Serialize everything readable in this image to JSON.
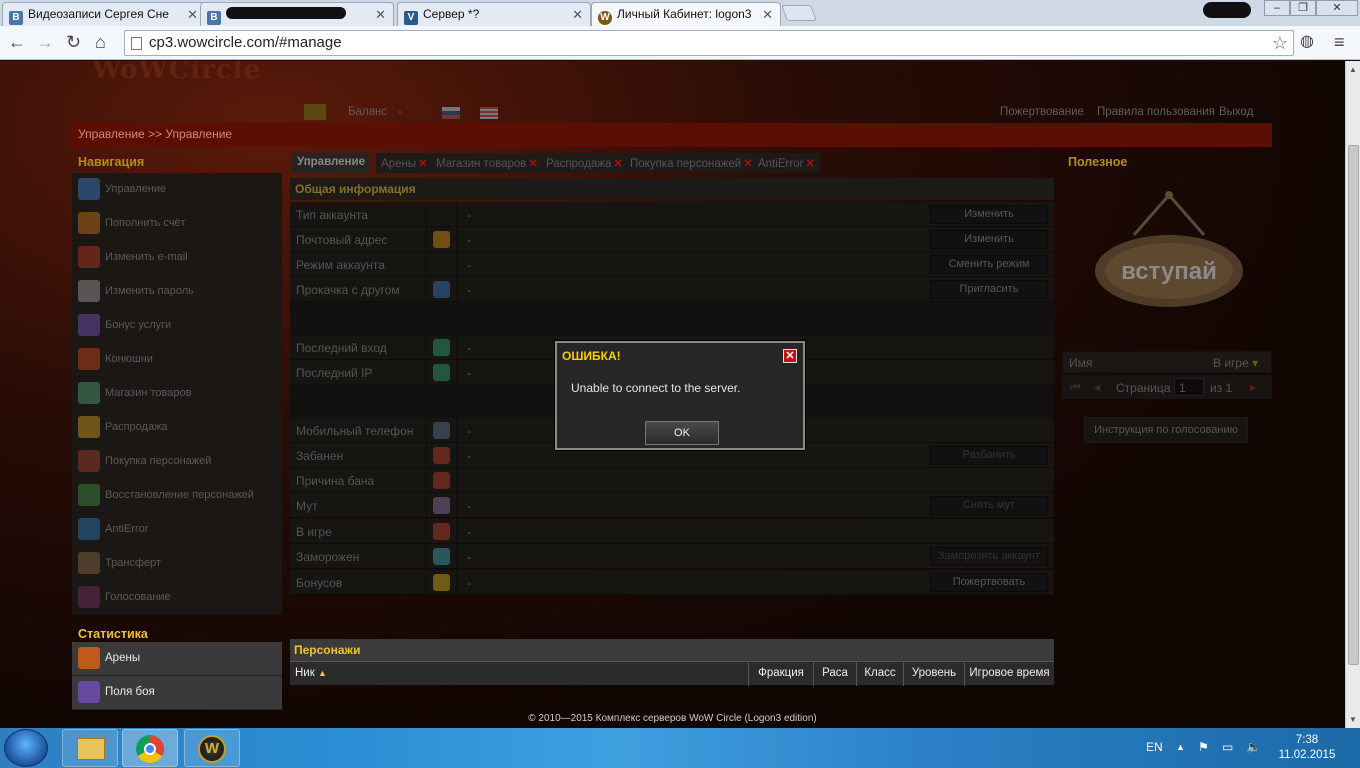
{
  "browser": {
    "tabs": [
      {
        "label": "Видеозаписи Сергея Сне",
        "icon": "vk-icon"
      },
      {
        "label": "",
        "icon": "vk-icon"
      },
      {
        "label": "Сервер *?",
        "icon": "vk-icon"
      },
      {
        "label": "Личный Кабинет: logon3",
        "icon": "wow-icon",
        "active": true
      }
    ],
    "url": "cp3.wowcircle.com/#manage"
  },
  "site": {
    "logo_text": "WoWCircle",
    "balance_label": "Баланс",
    "balance_value": "-",
    "top_links": [
      "Пожертвование",
      "Правила пользования",
      "Выход"
    ],
    "breadcrumb": "Управление >> Управление"
  },
  "nav": {
    "title": "Навигация",
    "items": [
      {
        "label": "Управление",
        "color": "#3a6fb0"
      },
      {
        "label": "Пополнить счёт",
        "color": "#b5651d"
      },
      {
        "label": "Изменить e-mail",
        "color": "#a0301a"
      },
      {
        "label": "Изменить пароль",
        "color": "#8a8a8a"
      },
      {
        "label": "Бонус услуги",
        "color": "#6a4aa0"
      },
      {
        "label": "Конюшни",
        "color": "#b0401a"
      },
      {
        "label": "Магазин товаров",
        "color": "#4a8a6a"
      },
      {
        "label": "Распродажа",
        "color": "#b08a1a"
      },
      {
        "label": "Покупка персонажей",
        "color": "#8a3a2a"
      },
      {
        "label": "Восстановление персонажей",
        "color": "#3a7a3a"
      },
      {
        "label": "AntiError",
        "color": "#2a6a9a"
      },
      {
        "label": "Трансферт",
        "color": "#7a5a3a"
      },
      {
        "label": "Голосование",
        "color": "#6a2a5a"
      }
    ]
  },
  "center_tabs": [
    "Управление",
    "Арены",
    "Магазин товаров",
    "Распродажа",
    "Покупка персонажей",
    "AntiError"
  ],
  "info": {
    "title": "Общая информация",
    "rows": [
      {
        "label": "Тип аккаунта",
        "value": "-",
        "button": "Изменить",
        "icon_color": ""
      },
      {
        "label": "Почтовый адрес",
        "value": "-",
        "button": "Изменить",
        "icon_color": "#c88a1a"
      },
      {
        "label": "Режим аккаунта",
        "value": "-",
        "button": "Сменить режим",
        "icon_color": ""
      },
      {
        "label": "Прокачка с другом",
        "value": "-",
        "button": "Пригласить",
        "icon_color": "#3a6fb0"
      },
      {
        "label": "Последний вход",
        "value": "-",
        "button": "",
        "icon_color": "#2a9a6a"
      },
      {
        "label": "Последний IP",
        "value": "-",
        "button": "",
        "icon_color": "#2a9a6a"
      },
      {
        "label": "Мобильный телефон",
        "value": "-",
        "button": "",
        "icon_color": "#5a6a8a"
      },
      {
        "label": "Забанен",
        "value": "-",
        "button": "Разбанить",
        "icon_color": "#b03a2a"
      },
      {
        "label": "Причина бана",
        "value": "",
        "button": "",
        "icon_color": "#b03a2a"
      },
      {
        "label": "Мут",
        "value": "-",
        "button": "Снять мут",
        "icon_color": "#8a6aa0"
      },
      {
        "label": "В игре",
        "value": "-",
        "button": "",
        "icon_color": "#b03a2a"
      },
      {
        "label": "Заморожен",
        "value": "-",
        "button": "Заморозить аккаунт",
        "icon_color": "#3a9aaa"
      },
      {
        "label": "Бонусов",
        "value": "-",
        "button": "Пожертвовать",
        "icon_color": "#c8a01a"
      }
    ]
  },
  "useful": {
    "title": "Полезное",
    "sign_text": "вступай",
    "search_placeholder": "Имя",
    "status_select": "В игре",
    "page_label": "Страница",
    "page_value": "1",
    "page_of": "из 1",
    "vote_button": "Инструкция по голосованию"
  },
  "stats": {
    "title": "Статистика",
    "items": [
      {
        "label": "Арены",
        "color": "#c05a1a"
      },
      {
        "label": "Поля боя",
        "color": "#6a4aa0"
      }
    ]
  },
  "characters": {
    "title": "Персонажи",
    "columns": [
      "Ник",
      "Фракция",
      "Раса",
      "Класс",
      "Уровень",
      "Игровое время"
    ]
  },
  "footer": "© 2010—2015 Комплекс серверов WoW Circle (Logon3 edition)",
  "dialog": {
    "title": "ОШИБКА!",
    "message": "Unable to connect to the server.",
    "ok": "OK"
  },
  "taskbar": {
    "lang": "EN",
    "time": "7:38",
    "date": "11.02.2015"
  }
}
